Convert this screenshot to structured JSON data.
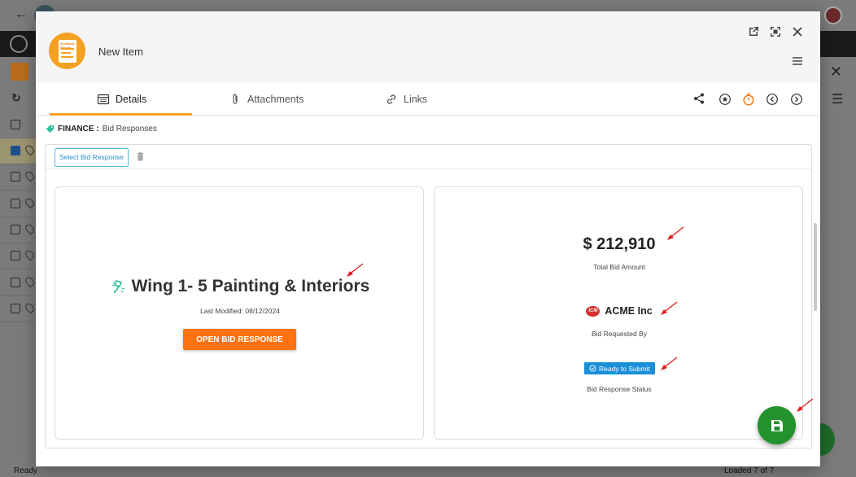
{
  "modal": {
    "title": "New Item",
    "logo_text": "Architect Report"
  },
  "tabs": [
    {
      "label": "Details",
      "icon": "details-icon",
      "active": true
    },
    {
      "label": "Attachments",
      "icon": "paperclip-icon",
      "active": false
    },
    {
      "label": "Links",
      "icon": "link-icon",
      "active": false
    }
  ],
  "breadcrumb": {
    "module": "FINANCE :",
    "section": "Bid Responses"
  },
  "toolbar": {
    "select_label": "Select Bid Response"
  },
  "bid": {
    "title": "Wing 1- 5 Painting & Interiors",
    "last_modified": "Last Modified: 08/12/2024",
    "open_label": "OPEN BID RESPONSE",
    "amount": "$ 212,910",
    "amount_label": "Total Bid Amount",
    "company": "ACME Inc",
    "company_logo_text": "ICM",
    "company_label": "Bid Requested By",
    "status": "Ready to Submit",
    "status_label": "Bid Response Status"
  },
  "background": {
    "status_ready": "Ready",
    "loaded": "Loaded 7 of 7"
  },
  "colors": {
    "accent": "#f5a020",
    "open_button": "#ff7212",
    "status_badge": "#1a8fd8",
    "fab": "#22922c",
    "arrow": "#e01b1b"
  }
}
